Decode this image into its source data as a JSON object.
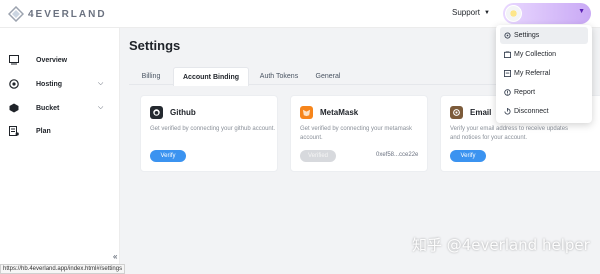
{
  "header": {
    "logo_text": "4EVERLAND",
    "support_label": "Support",
    "support_caret": "▼",
    "user_caret": "▼"
  },
  "sidebar": {
    "items": [
      {
        "label": "Overview",
        "icon": "overview-icon"
      },
      {
        "label": "Hosting",
        "icon": "hosting-icon",
        "chevron": "⌵"
      },
      {
        "label": "Bucket",
        "icon": "bucket-icon",
        "chevron": "⌵"
      },
      {
        "label": "Plan",
        "icon": "plan-icon"
      }
    ],
    "collapse_glyph": "«"
  },
  "main": {
    "title": "Settings",
    "tabs": [
      {
        "label": "Billing"
      },
      {
        "label": "Account Binding",
        "active": true
      },
      {
        "label": "Auth Tokens"
      },
      {
        "label": "General"
      }
    ],
    "cards": [
      {
        "title": "Github",
        "icon": "github-icon",
        "desc": "Get verified by connecting your github account.",
        "button": "Verify"
      },
      {
        "title": "MetaMask",
        "icon": "metamask-icon",
        "desc": "Get verified by connecting your metamask account.",
        "button": "Verified",
        "address": "0xef58...cce22e"
      },
      {
        "title": "Email",
        "icon": "email-icon",
        "desc": "Verify your email address to receive updates and notices for your account.",
        "button": "Verify"
      }
    ]
  },
  "user_menu": {
    "items": [
      {
        "label": "Settings",
        "icon": "settings-icon",
        "active": true
      },
      {
        "label": "My Collection",
        "icon": "collection-icon"
      },
      {
        "label": "My Referral",
        "icon": "referral-icon"
      },
      {
        "label": "Report",
        "icon": "report-icon"
      },
      {
        "label": "Disconnect",
        "icon": "disconnect-icon"
      }
    ]
  },
  "statusbar": {
    "url": "https://hb.4everland.app/index.html#/settings"
  },
  "watermark": {
    "text": "知乎 @4everland helper"
  },
  "colors": {
    "accent": "#3b93f0",
    "user_pill": "#c9a9f5",
    "metamask": "#f6851b",
    "github": "#24292f",
    "email": "#7c5b3a"
  }
}
